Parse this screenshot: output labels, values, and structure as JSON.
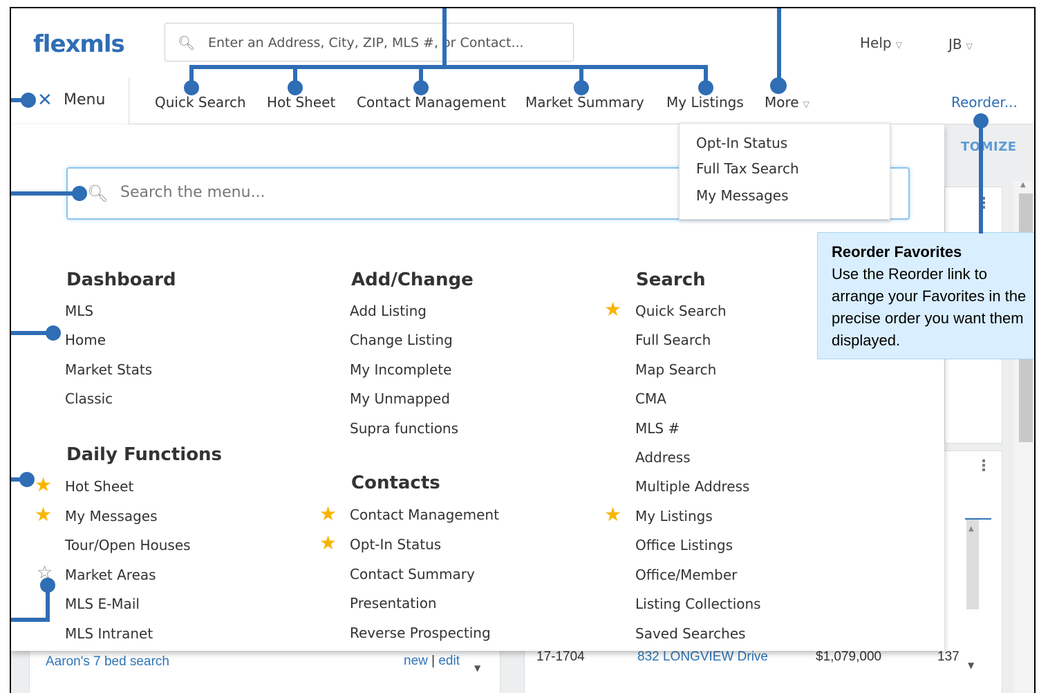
{
  "header": {
    "logo": "flexmls",
    "search_placeholder": "Enter an Address, City, ZIP, MLS #, or Contact...",
    "help_label": "Help",
    "user_label": "JB"
  },
  "nav": {
    "menu_label": "Menu",
    "items": [
      "Quick Search",
      "Hot Sheet",
      "Contact Management",
      "Market Summary",
      "My Listings",
      "More"
    ],
    "reorder_label": "Reorder..."
  },
  "more_dropdown": [
    "Opt-In Status",
    "Full Tax Search",
    "My Messages"
  ],
  "menu": {
    "search_placeholder": "Search the menu...",
    "columns": [
      {
        "sections": [
          {
            "heading": "Dashboard",
            "items": [
              {
                "label": "MLS",
                "star": "none"
              },
              {
                "label": "Home",
                "star": "none"
              },
              {
                "label": "Market Stats",
                "star": "none"
              },
              {
                "label": "Classic",
                "star": "none"
              }
            ]
          },
          {
            "heading": "Daily Functions",
            "items": [
              {
                "label": "Hot Sheet",
                "star": "filled"
              },
              {
                "label": "My Messages",
                "star": "filled"
              },
              {
                "label": "Tour/Open Houses",
                "star": "none"
              },
              {
                "label": "Market Areas",
                "star": "empty"
              },
              {
                "label": "MLS E-Mail",
                "star": "none"
              },
              {
                "label": "MLS Intranet",
                "star": "none"
              }
            ]
          }
        ]
      },
      {
        "sections": [
          {
            "heading": "Add/Change",
            "items": [
              {
                "label": "Add Listing",
                "star": "none"
              },
              {
                "label": "Change Listing",
                "star": "none"
              },
              {
                "label": "My Incomplete",
                "star": "none"
              },
              {
                "label": "My Unmapped",
                "star": "none"
              },
              {
                "label": "Supra functions",
                "star": "none"
              }
            ]
          },
          {
            "heading": "Contacts",
            "items": [
              {
                "label": "Contact Management",
                "star": "filled"
              },
              {
                "label": "Opt-In Status",
                "star": "filled"
              },
              {
                "label": "Contact Summary",
                "star": "none"
              },
              {
                "label": "Presentation",
                "star": "none"
              },
              {
                "label": "Reverse Prospecting",
                "star": "none"
              }
            ]
          }
        ]
      },
      {
        "sections": [
          {
            "heading": "Search",
            "items": [
              {
                "label": "Quick Search",
                "star": "filled"
              },
              {
                "label": "Full Search",
                "star": "none"
              },
              {
                "label": "Map Search",
                "star": "none"
              },
              {
                "label": "CMA",
                "star": "none"
              },
              {
                "label": "MLS #",
                "star": "none"
              },
              {
                "label": "Address",
                "star": "none"
              },
              {
                "label": "Multiple Address",
                "star": "none"
              },
              {
                "label": "My Listings",
                "star": "filled"
              },
              {
                "label": "Office Listings",
                "star": "none"
              },
              {
                "label": "Office/Member",
                "star": "none"
              },
              {
                "label": "Listing Collections",
                "star": "none"
              },
              {
                "label": "Saved Searches",
                "star": "none"
              }
            ]
          }
        ]
      }
    ]
  },
  "background": {
    "customize_label": "TOMIZE",
    "saved_search": "Aaron's 7 bed search",
    "new_label": "new",
    "separator": "|",
    "edit_label": "edit",
    "listing": {
      "mls": "17-1704",
      "address": "832 LONGVIEW Drive",
      "price": "$1,079,000",
      "dom": "137"
    }
  },
  "tooltip": {
    "title": "Reorder Favorites",
    "body": "Use the Reorder link to arrange your Favorites in the precise order you want them displayed."
  },
  "colors": {
    "brand": "#2f6db5",
    "star": "#f7b500",
    "tooltip_bg": "#d9efff"
  }
}
